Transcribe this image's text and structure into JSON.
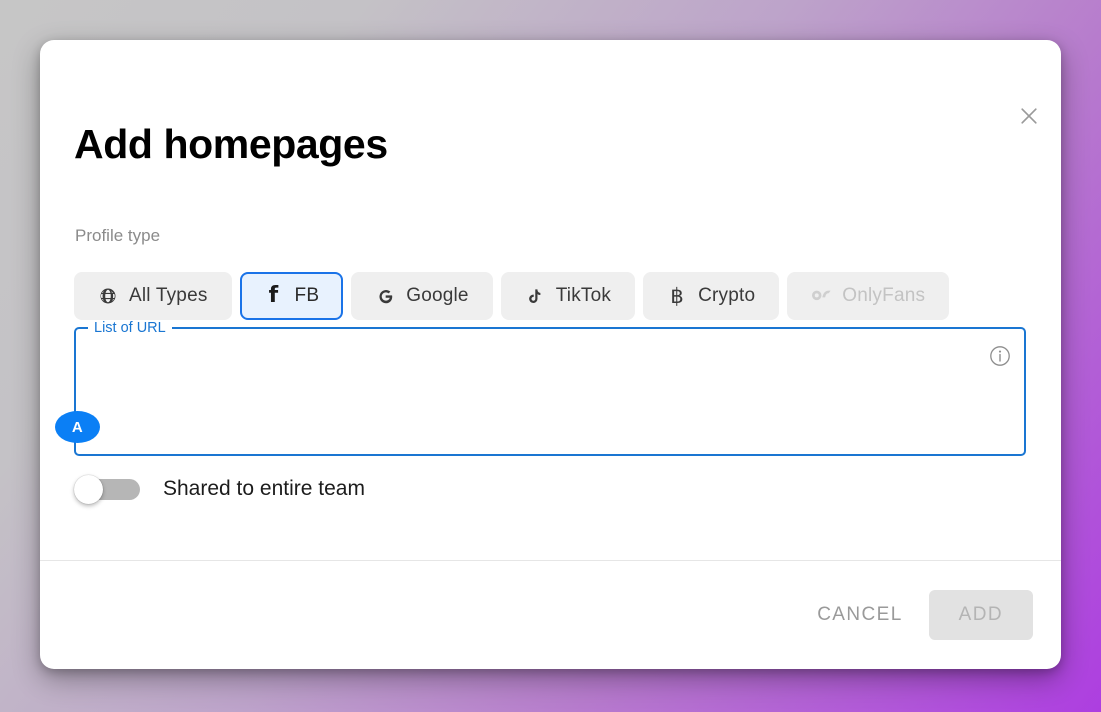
{
  "background": {
    "gradient_from": "#c6c6c6",
    "gradient_to": "#ad3ee0"
  },
  "dialog": {
    "title": "Add homepages",
    "close_icon": "close-icon",
    "profile_type": {
      "caption": "Profile type",
      "selected": "FB",
      "options": [
        {
          "label": "All Types",
          "icon": "globe-icon",
          "selected": false,
          "disabled": false
        },
        {
          "label": "FB",
          "icon": "facebook-icon",
          "selected": true,
          "disabled": false
        },
        {
          "label": "Google",
          "icon": "google-icon",
          "selected": false,
          "disabled": false
        },
        {
          "label": "TikTok",
          "icon": "tiktok-icon",
          "selected": false,
          "disabled": false
        },
        {
          "label": "Crypto",
          "icon": "bitcoin-icon",
          "selected": false,
          "disabled": false
        },
        {
          "label": "OnlyFans",
          "icon": "onlyfans-icon",
          "selected": false,
          "disabled": true
        }
      ]
    },
    "url_field": {
      "legend": "List of URL",
      "value": "",
      "placeholder": "",
      "info_icon": "info-circle-icon",
      "accent_color": "#1a76d2",
      "marker_badge": "A",
      "marker_color": "#0b7ff5"
    },
    "share_toggle": {
      "label": "Shared to entire team",
      "state": "off"
    },
    "footer": {
      "cancel_label": "CANCEL",
      "add_label": "ADD",
      "add_disabled": true
    }
  }
}
